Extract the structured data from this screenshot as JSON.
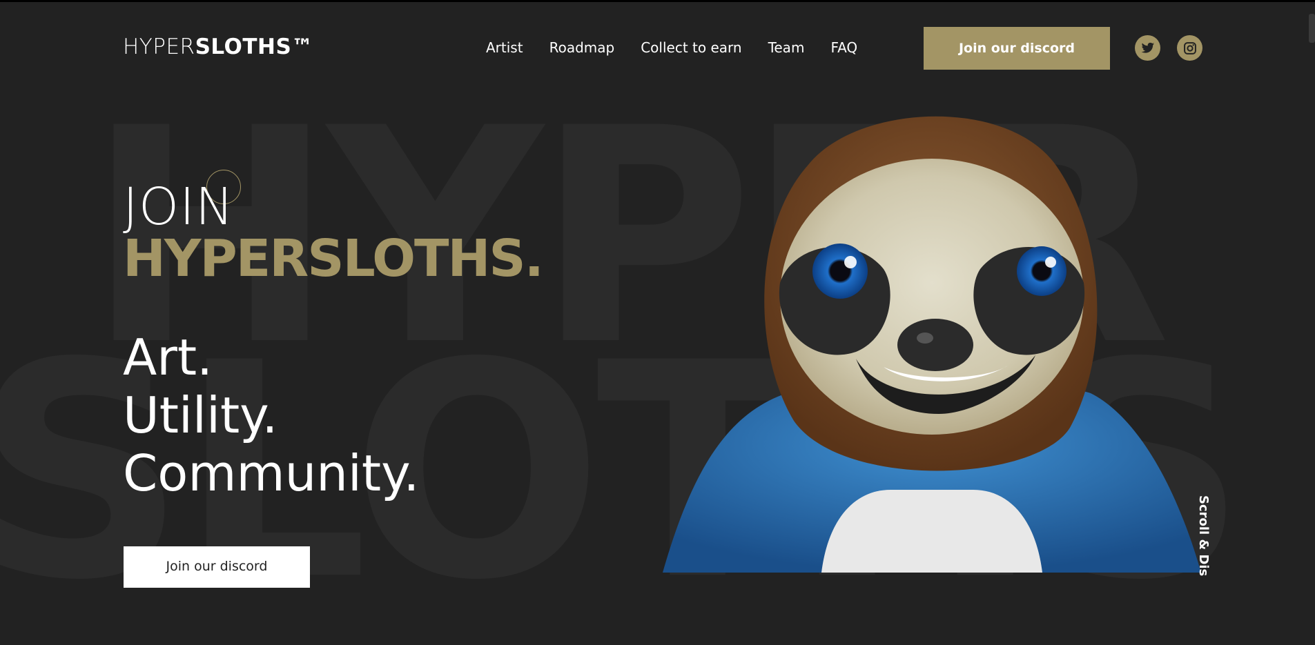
{
  "header": {
    "logo_light": "HYPER",
    "logo_bold": "SLOTHS™",
    "nav": [
      "Artist",
      "Roadmap",
      "Collect to earn",
      "Team",
      "FAQ"
    ],
    "cta_label": "Join our discord",
    "social": {
      "twitter_icon": "twitter-icon",
      "instagram_icon": "instagram-icon"
    }
  },
  "hero": {
    "join": "JOIN",
    "brand": "HYPERSLOTHS.",
    "tagline": [
      "Art.",
      "Utility.",
      "Community."
    ],
    "cta_label": "Join our discord",
    "scroll_hint": "Scroll & Dis",
    "bg_row1": "HYPER",
    "bg_row2": "SLOTHS"
  },
  "colors": {
    "accent": "#a39565",
    "background": "#222222",
    "watermark": "#2b2b2b"
  }
}
